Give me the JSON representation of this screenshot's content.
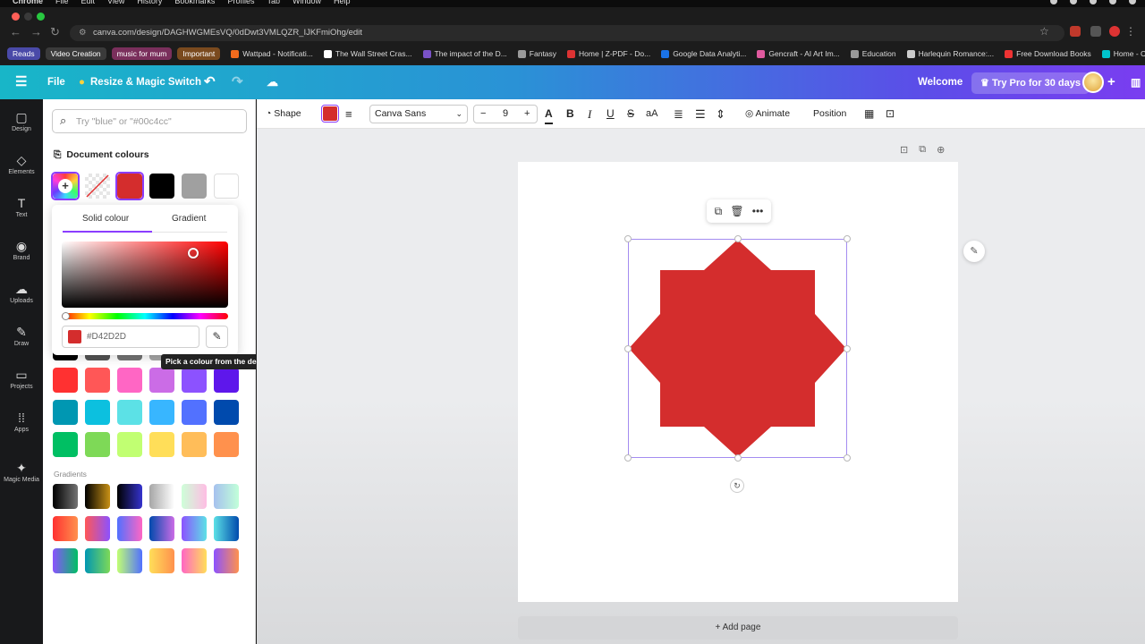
{
  "menubar": {
    "items": [
      "Chrome",
      "File",
      "Edit",
      "View",
      "History",
      "Bookmarks",
      "Profiles",
      "Tab",
      "Window",
      "Help"
    ]
  },
  "browser": {
    "url": "canva.com/design/DAGHWGMEsVQ/0dDwt3VMLQZR_IJKFmiOhg/edit"
  },
  "bookmarks": {
    "chips": [
      {
        "label": "Reads",
        "color": "#4a4aa8"
      },
      {
        "label": "Video Creation",
        "color": "#3a3a3a"
      },
      {
        "label": "music for mum",
        "color": "#7a2f5c"
      },
      {
        "label": "Important",
        "color": "#7a4a1e"
      }
    ],
    "items": [
      {
        "label": "Wattpad - Notificati...",
        "icon_color": "#f26b1d"
      },
      {
        "label": "The Wall Street Cras...",
        "icon_color": "#ffffff"
      },
      {
        "label": "The impact of the D...",
        "icon_color": "#7a52c7"
      },
      {
        "label": "Fantasy",
        "icon_color": "#9a9a9a"
      },
      {
        "label": "Home | Z-PDF - Do...",
        "icon_color": "#d33"
      },
      {
        "label": "Google Data Analyti...",
        "icon_color": "#1a73e8"
      },
      {
        "label": "Gencraft - AI Art Im...",
        "icon_color": "#e05a9e"
      },
      {
        "label": "Education",
        "icon_color": "#9a9a9a"
      },
      {
        "label": "Harlequin Romance:...",
        "icon_color": "#cccccc"
      },
      {
        "label": "Free Download Books",
        "icon_color": "#e33"
      },
      {
        "label": "Home - Canva",
        "icon_color": "#00c4cc"
      }
    ]
  },
  "header": {
    "file": "File",
    "resize": "Resize & Magic Switch",
    "welcome": "Welcome",
    "pro": "Try Pro for 30 days"
  },
  "rail": [
    {
      "icon": "design-icon",
      "glyph": "▢",
      "label": "Design"
    },
    {
      "icon": "elements-icon",
      "glyph": "◇",
      "label": "Elements"
    },
    {
      "icon": "text-icon",
      "glyph": "T",
      "label": "Text"
    },
    {
      "icon": "brand-icon",
      "glyph": "◉",
      "label": "Brand"
    },
    {
      "icon": "uploads-icon",
      "glyph": "☁",
      "label": "Uploads"
    },
    {
      "icon": "draw-icon",
      "glyph": "✎",
      "label": "Draw"
    },
    {
      "icon": "projects-icon",
      "glyph": "▭",
      "label": "Projects"
    },
    {
      "icon": "apps-icon",
      "glyph": "⁞⁞",
      "label": "Apps"
    },
    {
      "icon": "magic-media-icon",
      "glyph": "✦",
      "label": "Magic Media"
    }
  ],
  "panel": {
    "search_placeholder": "Try \"blue\" or \"#00c4cc\"",
    "document_colours_title": "Document colours",
    "document_colours": [
      "#d42d2d",
      "#000000",
      "#a0a0a0",
      "#ffffff"
    ],
    "gradients_label": "Gradients",
    "default_colours": [
      [
        "#ff3131",
        "#ff5757",
        "#ff66c4",
        "#cb6ce6",
        "#8c52ff",
        "#5e17eb"
      ],
      [
        "#0097b2",
        "#0cc0df",
        "#5ce1e6",
        "#38b6ff",
        "#5271ff",
        "#004aad"
      ],
      [
        "#00bf63",
        "#7ed957",
        "#c1ff72",
        "#ffde59",
        "#ffbd59",
        "#ff914d"
      ]
    ],
    "gradients": [
      [
        "#000000|#737373",
        "#000000|#c89116",
        "#000000|#3533cd",
        "#a6a6a6|#ffffff",
        "#cdffd8|#ffbde4",
        "#a6c1ee|#c1ffd9"
      ],
      [
        "#ff3131|#ff914d",
        "#ff5757|#8c52ff",
        "#5170ff|#ff66c4",
        "#004aad|#cb6ce6",
        "#8c52ff|#5ce1e6",
        "#5ce1e6|#004aad"
      ],
      [
        "#8c52ff|#00bf63",
        "#0097b2|#7ed957",
        "#c1ff72|#5170ff",
        "#ffde59|#ff914d",
        "#ff66c4|#ffde59",
        "#8c52ff|#ff914d"
      ]
    ]
  },
  "picker": {
    "tab_solid": "Solid colour",
    "tab_gradient": "Gradient",
    "hex": "#D42D2D",
    "tooltip": "Pick a colour from the design"
  },
  "toolbar": {
    "shape": "Shape",
    "font": "Canva Sans",
    "size": "9",
    "animate": "Animate",
    "position": "Position"
  },
  "canvas": {
    "shape_color": "#d42d2d",
    "add_page": "+ Add page"
  }
}
